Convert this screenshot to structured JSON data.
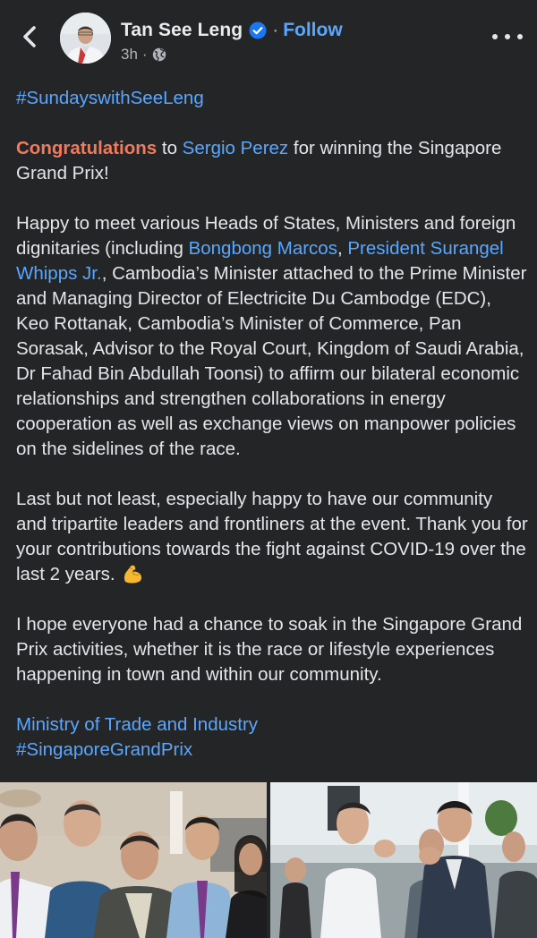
{
  "post": {
    "author": "Tan See Leng",
    "follow_label": "Follow",
    "dot_separator": "·",
    "time": "3h",
    "privacy_icon": "globe-icon",
    "verified_icon": "verified-badge-icon",
    "hashtag_top": "#SundayswithSeeLeng",
    "paragraph1": {
      "congrats": "Congratulations",
      "to": " to ",
      "person_link": "Sergio Perez",
      "rest": " for winning the Singapore Grand Prix!"
    },
    "paragraph2": {
      "start": "Happy to meet various Heads of States, Ministers and foreign dignitaries (including ",
      "link1": "Bongbong Marcos",
      "comma": ", ",
      "link2": "President Surangel Whipps Jr.",
      "rest": ", Cambodia’s Minister attached to the Prime Minister and Managing Director of Electricite Du Cambodge (EDC), Keo Rottanak, Cambodia’s Minister of Commerce, Pan Sorasak, Advisor to the Royal Court, Kingdom of Saudi Arabia, Dr Fahad Bin Abdullah Toonsi) to affirm our bilateral economic relationships and strengthen collaborations in energy cooperation as well as exchange views on manpower policies on the sidelines of the race."
    },
    "paragraph3": "Last but not least, especially happy to have our community and tripartite leaders and frontliners at the event. Thank you for your contributions towards the fight against COVID-19 over the last 2 years. ",
    "paragraph3_emoji": "flexed-biceps-emoji",
    "paragraph4": "I hope everyone had a chance to soak in the Singapore Grand Prix activities, whether it is the race or lifestyle experiences happening in town and within our community.",
    "tag_page": "Ministry of Trade and Industry",
    "hashtag_bottom": "#SingaporeGrandPrix"
  },
  "icons": {
    "back": "back-arrow-icon",
    "more": "more-options-icon"
  },
  "colors": {
    "background": "#242526",
    "text": "#e4e6eb",
    "link": "#5aa7ff",
    "congrats": "#f07a5e",
    "secondary": "#b0b3b8",
    "verified": "#1877f2"
  }
}
